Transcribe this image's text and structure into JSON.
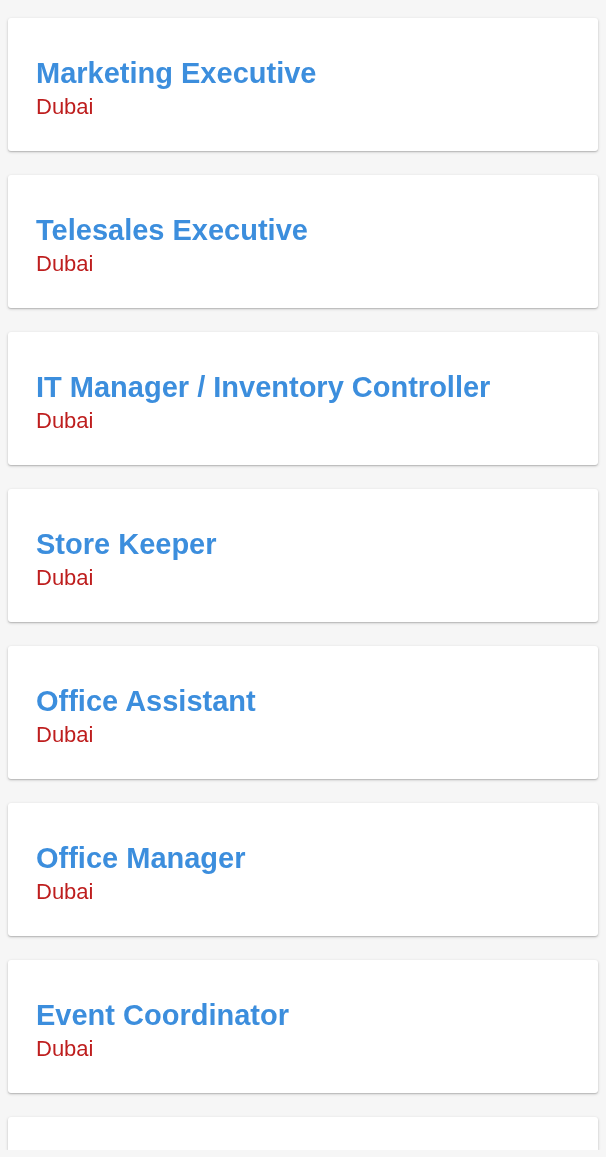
{
  "jobs": [
    {
      "title": "Marketing Executive",
      "location": "Dubai"
    },
    {
      "title": "Telesales Executive",
      "location": "Dubai"
    },
    {
      "title": "IT Manager / Inventory Controller",
      "location": "Dubai"
    },
    {
      "title": "Store Keeper",
      "location": "Dubai"
    },
    {
      "title": "Office Assistant",
      "location": "Dubai"
    },
    {
      "title": "Office Manager",
      "location": "Dubai"
    },
    {
      "title": "Event Coordinator",
      "location": "Dubai"
    }
  ],
  "partial_card": true
}
